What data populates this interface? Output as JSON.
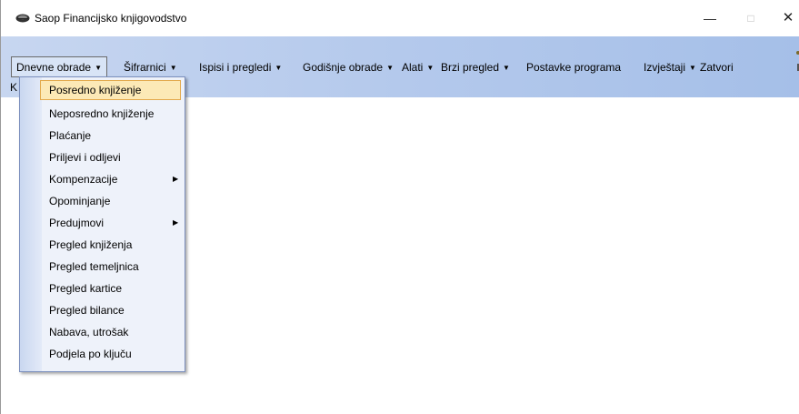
{
  "window": {
    "title": "Saop Financijsko knjigovodstvo",
    "min": "—",
    "max": "□",
    "close": "✕"
  },
  "menubar": {
    "items": [
      {
        "label": "Dnevne obrade",
        "has_dropdown": true,
        "active": true
      },
      {
        "label": "Šifrarnici",
        "has_dropdown": true
      },
      {
        "label": "Ispisi i pregledi",
        "has_dropdown": true
      },
      {
        "label": "Godišnje obrade",
        "has_dropdown": true
      },
      {
        "label": "Alati",
        "has_dropdown": true
      },
      {
        "label": "Brzi pregled",
        "has_dropdown": true
      },
      {
        "label": "Postavke programa",
        "has_dropdown": false
      },
      {
        "label": "Izvještaji",
        "has_dropdown": true
      },
      {
        "label": "Zatvori",
        "has_dropdown": false
      }
    ],
    "left_partial": "K"
  },
  "dropdown": {
    "items": [
      {
        "label": "Posredno knjiženje",
        "selected": true
      },
      {
        "label": "Neposredno knjiženje"
      },
      {
        "label": "Plaćanje"
      },
      {
        "label": "Priljevi i odljevi"
      },
      {
        "label": "Kompenzacije",
        "submenu": true
      },
      {
        "label": "Opominjanje"
      },
      {
        "label": "Predujmovi",
        "submenu": true
      },
      {
        "label": "Pregled knjiženja"
      },
      {
        "label": "Pregled temeljnica"
      },
      {
        "label": "Pregled kartice"
      },
      {
        "label": "Pregled bilance"
      },
      {
        "label": "Nabava, utrošak"
      },
      {
        "label": "Podjela po ključu"
      }
    ]
  },
  "colors": {
    "menubar_gradient_start": "#c7d6f0",
    "menubar_gradient_end": "#a5bfe8",
    "selected_item_bg": "#fce9b6",
    "selected_item_border": "#e3a94b"
  }
}
